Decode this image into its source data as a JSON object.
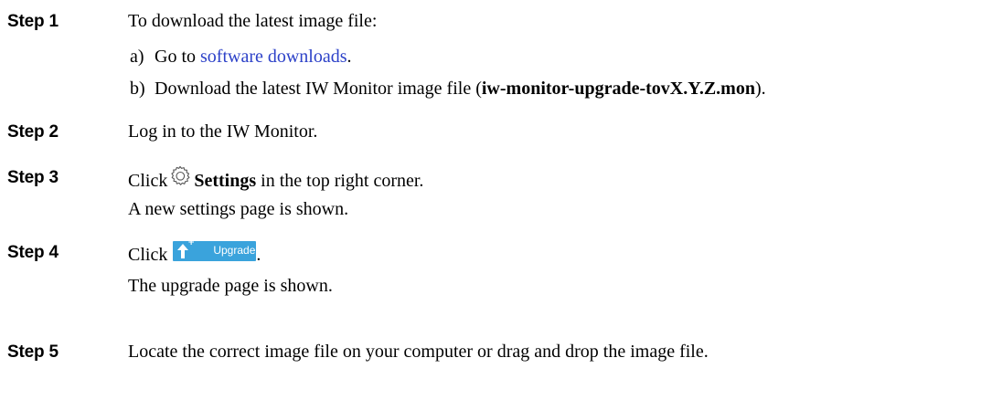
{
  "steps": [
    {
      "label": "Step 1",
      "text": "To download the latest image file:",
      "subs": [
        {
          "letter": "a)",
          "pre": "Go to ",
          "link": "software downloads",
          "post": "."
        },
        {
          "letter": "b)",
          "pre": "Download the latest IW Monitor image file (",
          "bold": "iw-monitor-upgrade-tovX.Y.Z.mon",
          "post": ")."
        }
      ]
    },
    {
      "label": "Step 2",
      "text": "Log in to the IW Monitor."
    },
    {
      "label": "Step 3",
      "pre": "Click",
      "bold": "Settings",
      "post": " in the top right corner.",
      "result": "A new settings page is shown.",
      "icon": "gear-icon"
    },
    {
      "label": "Step 4",
      "pre": "Click",
      "button": {
        "label": "Upgrade",
        "icon": "upload-arrow-icon",
        "plus": "+",
        "color": "#3aa3dc"
      },
      "post": ".",
      "result": "The upgrade page is shown."
    },
    {
      "label": "Step 5",
      "text": "Locate the correct image file on your computer or drag and drop the image file."
    }
  ],
  "link_color": "#2c41c8"
}
